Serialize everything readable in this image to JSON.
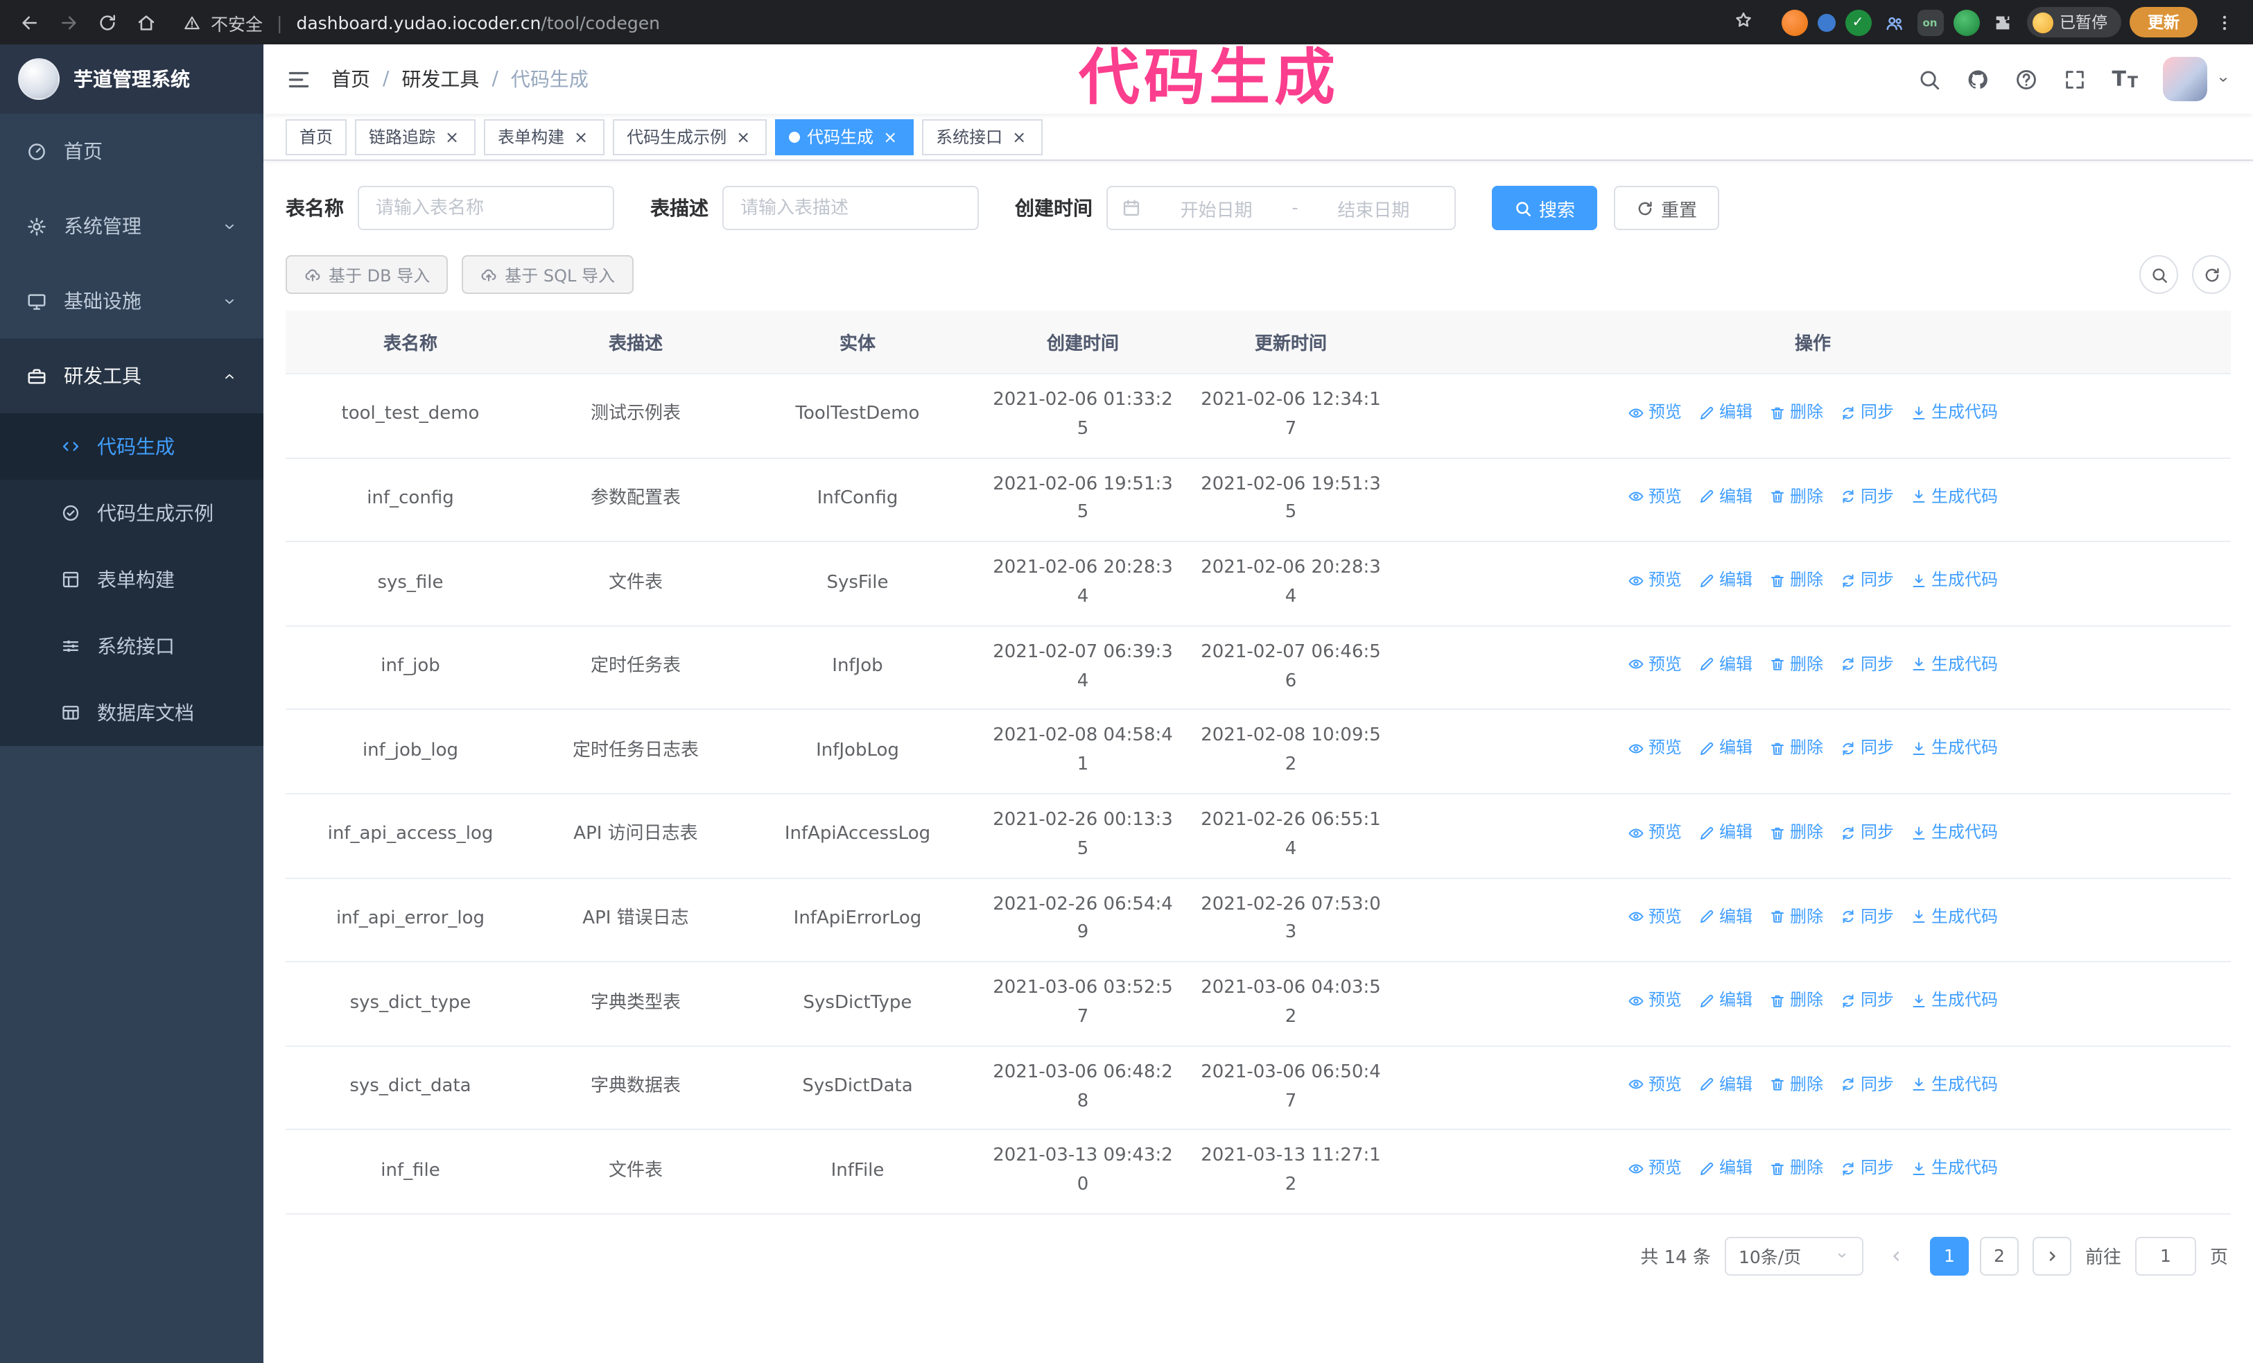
{
  "colors": {
    "accent": "#409eff",
    "annotation": "#fb3e8d"
  },
  "annotation": {
    "text": "代码生成"
  },
  "browser": {
    "security_label": "不安全",
    "url_host": "dashboard.yudao.iocoder.cn",
    "url_path": "/tool/codegen",
    "paused_badge": "已暂停",
    "update_button": "更新"
  },
  "app": {
    "logo_title": "芋道管理系统"
  },
  "sidebar": {
    "items": [
      {
        "key": "home",
        "label": "首页",
        "icon": "dashboard-icon",
        "chevron": null,
        "highlight": false
      },
      {
        "key": "system",
        "label": "系统管理",
        "icon": "gear-icon",
        "chevron": "down",
        "highlight": false
      },
      {
        "key": "infrastructure",
        "label": "基础设施",
        "icon": "monitor-icon",
        "chevron": "down",
        "highlight": false
      },
      {
        "key": "dev-tools",
        "label": "研发工具",
        "icon": "toolbox-icon",
        "chevron": "up",
        "highlight": true
      }
    ],
    "submenu": [
      {
        "key": "codegen",
        "label": "代码生成",
        "icon": "code-icon",
        "active": true
      },
      {
        "key": "codegen-example",
        "label": "代码生成示例",
        "icon": "badge-check-icon",
        "active": false
      },
      {
        "key": "form-builder",
        "label": "表单构建",
        "icon": "form-icon",
        "active": false
      },
      {
        "key": "system-api",
        "label": "系统接口",
        "icon": "sliders-icon",
        "active": false
      },
      {
        "key": "db-doc",
        "label": "数据库文档",
        "icon": "table-grid-icon",
        "active": false
      }
    ]
  },
  "breadcrumb": {
    "separator": "/",
    "items": [
      "首页",
      "研发工具",
      "代码生成"
    ]
  },
  "tabs": [
    {
      "label": "首页",
      "closable": false,
      "active": false
    },
    {
      "label": "链路追踪",
      "closable": true,
      "active": false
    },
    {
      "label": "表单构建",
      "closable": true,
      "active": false
    },
    {
      "label": "代码生成示例",
      "closable": true,
      "active": false
    },
    {
      "label": "代码生成",
      "closable": true,
      "active": true
    },
    {
      "label": "系统接口",
      "closable": true,
      "active": false
    }
  ],
  "filters": {
    "table_name_label": "表名称",
    "table_name_placeholder": "请输入表名称",
    "table_desc_label": "表描述",
    "table_desc_placeholder": "请输入表描述",
    "create_time_label": "创建时间",
    "date_start_placeholder": "开始日期",
    "date_separator": "-",
    "date_end_placeholder": "结束日期",
    "search_button": "搜索",
    "reset_button": "重置"
  },
  "toolbar": {
    "import_db": "基于 DB 导入",
    "import_sql": "基于 SQL 导入"
  },
  "table": {
    "headers": [
      "表名称",
      "表描述",
      "实体",
      "创建时间",
      "更新时间",
      "操作"
    ],
    "actions": [
      {
        "key": "preview",
        "label": "预览",
        "icon": "eye-icon"
      },
      {
        "key": "edit",
        "label": "编辑",
        "icon": "edit-icon"
      },
      {
        "key": "delete",
        "label": "删除",
        "icon": "delete-icon"
      },
      {
        "key": "sync",
        "label": "同步",
        "icon": "sync-icon"
      },
      {
        "key": "generate-code",
        "label": "生成代码",
        "icon": "download-icon"
      }
    ],
    "rows": [
      {
        "name": "tool_test_demo",
        "description": "测试示例表",
        "entity": "ToolTestDemo",
        "created": "2021-02-06 01:33:25",
        "updated": "2021-02-06 12:34:17"
      },
      {
        "name": "inf_config",
        "description": "参数配置表",
        "entity": "InfConfig",
        "created": "2021-02-06 19:51:35",
        "updated": "2021-02-06 19:51:35"
      },
      {
        "name": "sys_file",
        "description": "文件表",
        "entity": "SysFile",
        "created": "2021-02-06 20:28:34",
        "updated": "2021-02-06 20:28:34"
      },
      {
        "name": "inf_job",
        "description": "定时任务表",
        "entity": "InfJob",
        "created": "2021-02-07 06:39:34",
        "updated": "2021-02-07 06:46:56"
      },
      {
        "name": "inf_job_log",
        "description": "定时任务日志表",
        "entity": "InfJobLog",
        "created": "2021-02-08 04:58:41",
        "updated": "2021-02-08 10:09:52"
      },
      {
        "name": "inf_api_access_log",
        "description": "API 访问日志表",
        "entity": "InfApiAccessLog",
        "created": "2021-02-26 00:13:35",
        "updated": "2021-02-26 06:55:14"
      },
      {
        "name": "inf_api_error_log",
        "description": "API 错误日志",
        "entity": "InfApiErrorLog",
        "created": "2021-02-26 06:54:49",
        "updated": "2021-02-26 07:53:03"
      },
      {
        "name": "sys_dict_type",
        "description": "字典类型表",
        "entity": "SysDictType",
        "created": "2021-03-06 03:52:57",
        "updated": "2021-03-06 04:03:52"
      },
      {
        "name": "sys_dict_data",
        "description": "字典数据表",
        "entity": "SysDictData",
        "created": "2021-03-06 06:48:28",
        "updated": "2021-03-06 06:50:47"
      },
      {
        "name": "inf_file",
        "description": "文件表",
        "entity": "InfFile",
        "created": "2021-03-13 09:43:20",
        "updated": "2021-03-13 11:27:12"
      }
    ]
  },
  "pagination": {
    "total": "共 14 条",
    "page_size": "10条/页",
    "pages": [
      {
        "label": "1",
        "active": true
      },
      {
        "label": "2",
        "active": false
      }
    ],
    "goto_label": "前往",
    "goto_value": "1",
    "goto_unit": "页"
  }
}
